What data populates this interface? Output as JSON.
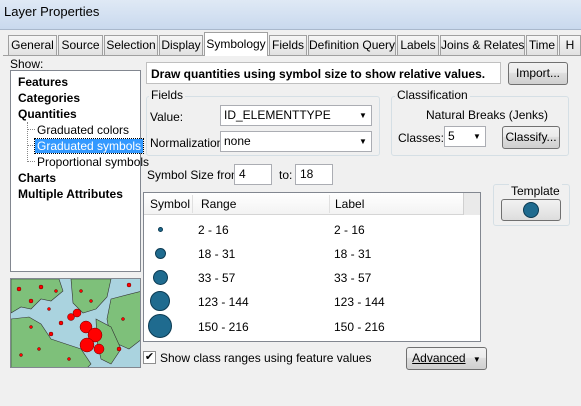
{
  "window": {
    "title": "Layer Properties"
  },
  "tabs": [
    {
      "label": "General"
    },
    {
      "label": "Source"
    },
    {
      "label": "Selection"
    },
    {
      "label": "Display"
    },
    {
      "label": "Symbology",
      "active": true
    },
    {
      "label": "Fields"
    },
    {
      "label": "Definition Query"
    },
    {
      "label": "Labels"
    },
    {
      "label": "Joins & Relates"
    },
    {
      "label": "Time"
    },
    {
      "label": "H"
    }
  ],
  "show_panel": {
    "label": "Show:",
    "items": [
      {
        "label": "Features",
        "level": 0
      },
      {
        "label": "Categories",
        "level": 0
      },
      {
        "label": "Quantities",
        "level": 0
      },
      {
        "label": "Graduated colors",
        "level": 1
      },
      {
        "label": "Graduated symbols",
        "level": 1,
        "selected": true
      },
      {
        "label": "Proportional symbols",
        "level": 1
      },
      {
        "label": "Charts",
        "level": 0
      },
      {
        "label": "Multiple Attributes",
        "level": 0
      }
    ]
  },
  "description": "Draw quantities using symbol size to show relative values.",
  "import_button": "Import...",
  "fields": {
    "group_title": "Fields",
    "value_label": "Value:",
    "value": "ID_ELEMENTTYPE",
    "normalization_label": "Normalization:",
    "normalization": "none"
  },
  "classification": {
    "group_title": "Classification",
    "method": "Natural Breaks (Jenks)",
    "classes_label": "Classes:",
    "classes": "5",
    "classify_button": "Classify..."
  },
  "symbol_size": {
    "from_label": "Symbol Size from:",
    "from": "4",
    "to_label": "to:",
    "to": "18"
  },
  "template": {
    "label": "Template"
  },
  "table": {
    "headers": {
      "symbol": "Symbol",
      "range": "Range",
      "label": "Label"
    },
    "rows": [
      {
        "range": "2 - 16",
        "label": "2 - 16",
        "size": 4
      },
      {
        "range": "18 - 31",
        "label": "18 - 31",
        "size": 8
      },
      {
        "range": "33 - 57",
        "label": "33 - 57",
        "size": 11
      },
      {
        "range": "123 - 144",
        "label": "123 - 144",
        "size": 15
      },
      {
        "range": "150 - 216",
        "label": "150 - 216",
        "size": 18
      }
    ]
  },
  "show_class_ranges": {
    "label": "Show class ranges using feature values",
    "checked": true
  },
  "advanced_button": "Advanced",
  "colors": {
    "symbol_fill": "#1f6b8f",
    "selection": "#3399ff",
    "map_water": "#aad3df",
    "map_land": "#7ec07a",
    "map_points": "#ff0000"
  }
}
